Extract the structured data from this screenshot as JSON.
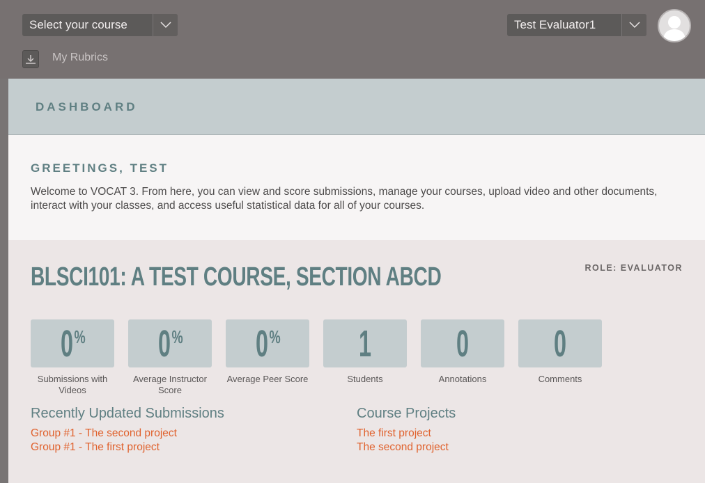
{
  "topbar": {
    "course_select": "Select your course",
    "user_select": "Test Evaluator1",
    "my_rubrics": "My Rubrics"
  },
  "dashboard": {
    "title": "DASHBOARD"
  },
  "greeting": {
    "title": "GREETINGS, TEST",
    "text": "Welcome to VOCAT 3. From here, you can view and score submissions, manage your courses, upload video and other documents, interact with your classes, and access useful statistical data for all of your courses."
  },
  "course": {
    "title": "BLSCI101: A TEST COURSE, SECTION ABCD",
    "role": "ROLE: EVALUATOR",
    "stats": [
      {
        "value": "0",
        "suffix": "%",
        "caption": "Submissions with Videos"
      },
      {
        "value": "0",
        "suffix": "%",
        "caption": "Average Instructor Score"
      },
      {
        "value": "0",
        "suffix": "%",
        "caption": "Average Peer Score"
      },
      {
        "value": "1",
        "suffix": "",
        "caption": "Students"
      },
      {
        "value": "0",
        "suffix": "",
        "caption": "Annotations"
      },
      {
        "value": "0",
        "suffix": "",
        "caption": "Comments"
      }
    ],
    "recent": {
      "title": "Recently Updated Submissions",
      "items": [
        "Group #1 - The second project",
        "Group #1 - The first project"
      ]
    },
    "projects": {
      "title": "Course Projects",
      "items": [
        "The first project",
        "The second project"
      ]
    }
  },
  "colors": {
    "accent": "#5f7f82",
    "link": "#e0622e",
    "topbar": "#777171"
  }
}
